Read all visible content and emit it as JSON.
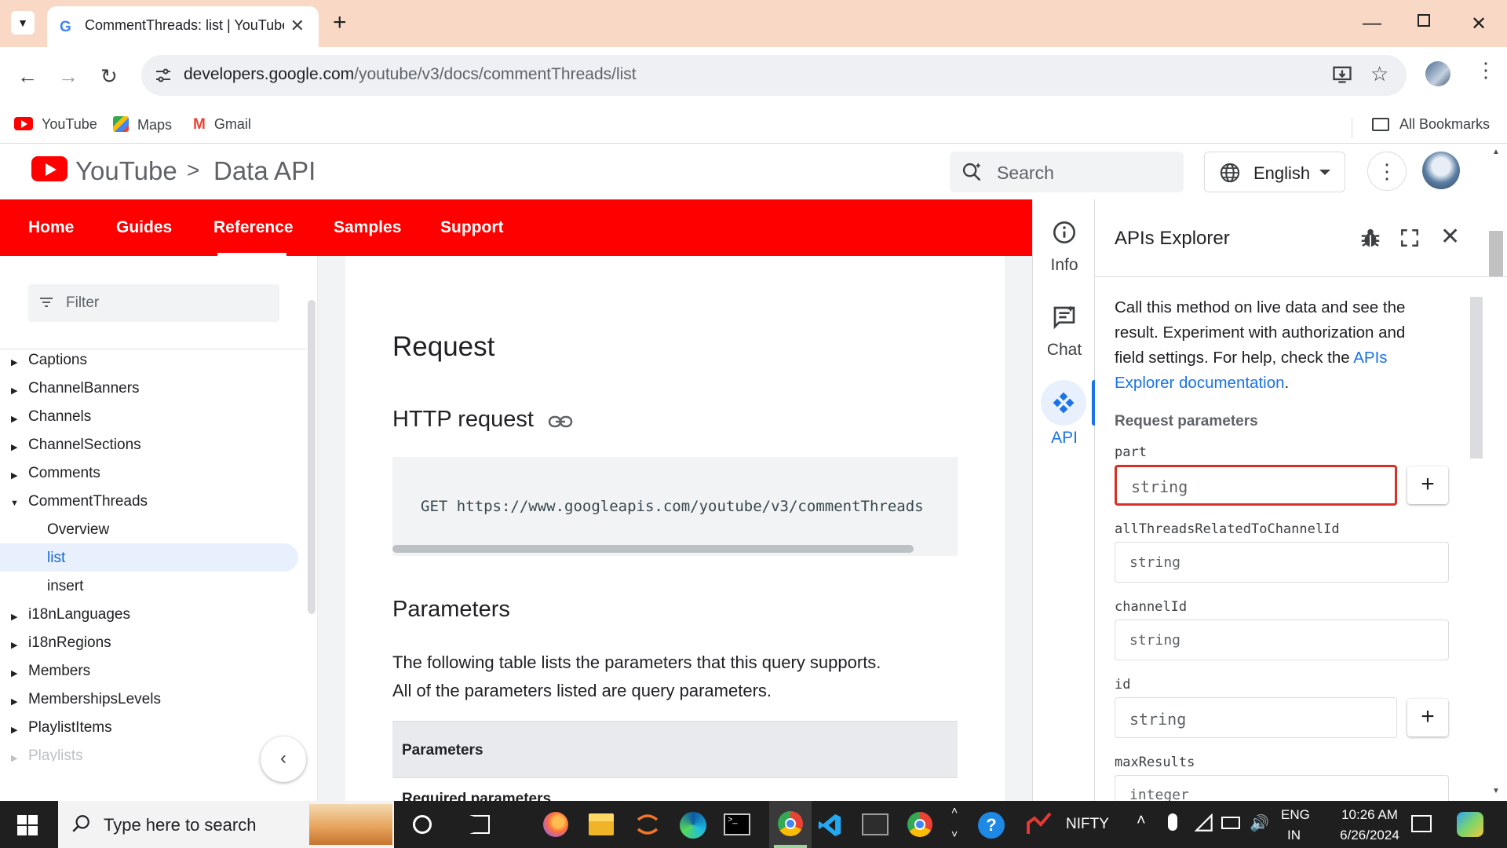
{
  "browser": {
    "tab_title": "CommentThreads: list  |  YouTube",
    "url_domain": "developers.google.com",
    "url_path": "/youtube/v3/docs/commentThreads/list",
    "bookmarks": [
      "YouTube",
      "Maps",
      "Gmail"
    ],
    "all_bookmarks": "All Bookmarks"
  },
  "site": {
    "product": "YouTube",
    "separator": ">",
    "section": "Data API",
    "search_placeholder": "Search",
    "language": "English",
    "nav": [
      "Home",
      "Guides",
      "Reference",
      "Samples",
      "Support"
    ],
    "active_nav": "Reference"
  },
  "sidebar": {
    "filter_placeholder": "Filter",
    "items": [
      "Captions",
      "ChannelBanners",
      "Channels",
      "ChannelSections",
      "Comments",
      "CommentThreads",
      "Overview",
      "list",
      "insert",
      "i18nLanguages",
      "i18nRegions",
      "Members",
      "MembershipsLevels",
      "PlaylistItems",
      "Playlists"
    ],
    "selected": "list"
  },
  "doc": {
    "h_request": "Request",
    "h_http": "HTTP request",
    "code": "GET https://www.googleapis.com/youtube/v3/commentThreads",
    "h_params": "Parameters",
    "params_text_1": "The following table lists the parameters that this query supports.",
    "params_text_2": "All of the parameters listed are query parameters.",
    "table_header": "Parameters",
    "table_sub": "Required parameters"
  },
  "rail": {
    "info": "Info",
    "chat": "Chat",
    "api": "API"
  },
  "explorer": {
    "title": "APIs Explorer",
    "intro_1": "Call this method on live data and see the",
    "intro_2": "result. Experiment with authorization and",
    "intro_3": "field settings. For help, check the ",
    "intro_link_1": "APIs",
    "intro_link_2": "Explorer documentation",
    "intro_end": ".",
    "req_params": "Request parameters",
    "params": [
      {
        "name": "part",
        "placeholder": "string"
      },
      {
        "name": "allThreadsRelatedToChannelId",
        "placeholder": "string"
      },
      {
        "name": "channelId",
        "placeholder": "string"
      },
      {
        "name": "id",
        "placeholder": "string"
      },
      {
        "name": "maxResults",
        "placeholder": "integer"
      }
    ]
  },
  "taskbar": {
    "search_placeholder": "Type here to search",
    "stock": "NIFTY",
    "lang_1": "ENG",
    "lang_2": "IN",
    "time": "10:26 AM",
    "date": "6/26/2024"
  },
  "colors": {
    "youtube_red": "#ff0000",
    "link_blue": "#1a73e8",
    "error_red": "#d93025",
    "tabbar": "#f9d9c6"
  }
}
